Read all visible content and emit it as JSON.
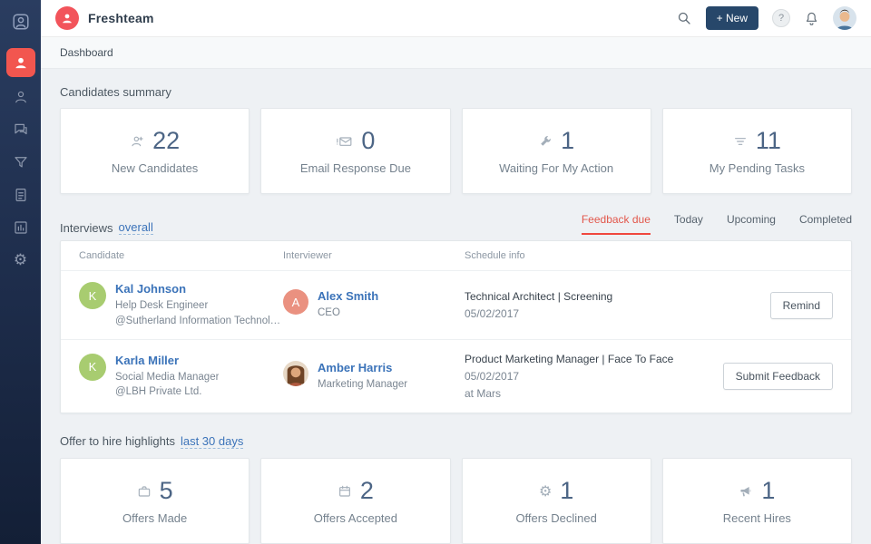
{
  "header": {
    "app_name": "Freshteam",
    "new_button": "+ New",
    "help_label": "?"
  },
  "breadcrumb": "Dashboard",
  "colors": {
    "accent": "#f2545b",
    "link": "#3b73b9",
    "active_tab": "#e2574b",
    "sidebar": "#1d2c4a"
  },
  "candidates_summary": {
    "title": "Candidates summary",
    "cards": [
      {
        "value": "22",
        "label": "New Candidates",
        "icon": "person-icon"
      },
      {
        "value": "0",
        "label": "Email Response Due",
        "icon": "alert-envelope-icon"
      },
      {
        "value": "1",
        "label": "Waiting For My Action",
        "icon": "wrench-icon"
      },
      {
        "value": "11",
        "label": "My Pending Tasks",
        "icon": "task-lines-icon"
      }
    ]
  },
  "interviews": {
    "title": "Interviews",
    "filter_link": "overall",
    "tabs": [
      "Feedback due",
      "Today",
      "Upcoming",
      "Completed"
    ],
    "columns": [
      "Candidate",
      "Interviewer",
      "Schedule info"
    ],
    "rows": [
      {
        "candidate_initial": "K",
        "candidate_name": "Kal Johnson",
        "candidate_title": "Help Desk Engineer",
        "candidate_company": "@Sutherland Information Technolo...",
        "interviewer_initial": "A",
        "interviewer_name": "Alex Smith",
        "interviewer_title": "CEO",
        "schedule_line1": "Technical Architect | Screening",
        "schedule_line2": "05/02/2017",
        "schedule_line3": "",
        "action": "Remind"
      },
      {
        "candidate_initial": "K",
        "candidate_name": "Karla Miller",
        "candidate_title": "Social Media Manager",
        "candidate_company": "@LBH Private Ltd.",
        "interviewer_name": "Amber Harris",
        "interviewer_title": "Marketing Manager",
        "schedule_line1": "Product Marketing Manager | Face To Face",
        "schedule_line2": "05/02/2017",
        "schedule_line3": "at Mars",
        "action": "Submit Feedback"
      }
    ]
  },
  "offer_highlights": {
    "title": "Offer to hire highlights",
    "filter_link": "last 30 days",
    "cards": [
      {
        "value": "5",
        "label": "Offers Made",
        "icon": "briefcase-icon"
      },
      {
        "value": "2",
        "label": "Offers Accepted",
        "icon": "calendar-icon"
      },
      {
        "value": "1",
        "label": "Offers Declined",
        "icon": "gear-icon"
      },
      {
        "value": "1",
        "label": "Recent Hires",
        "icon": "megaphone-icon"
      }
    ]
  }
}
